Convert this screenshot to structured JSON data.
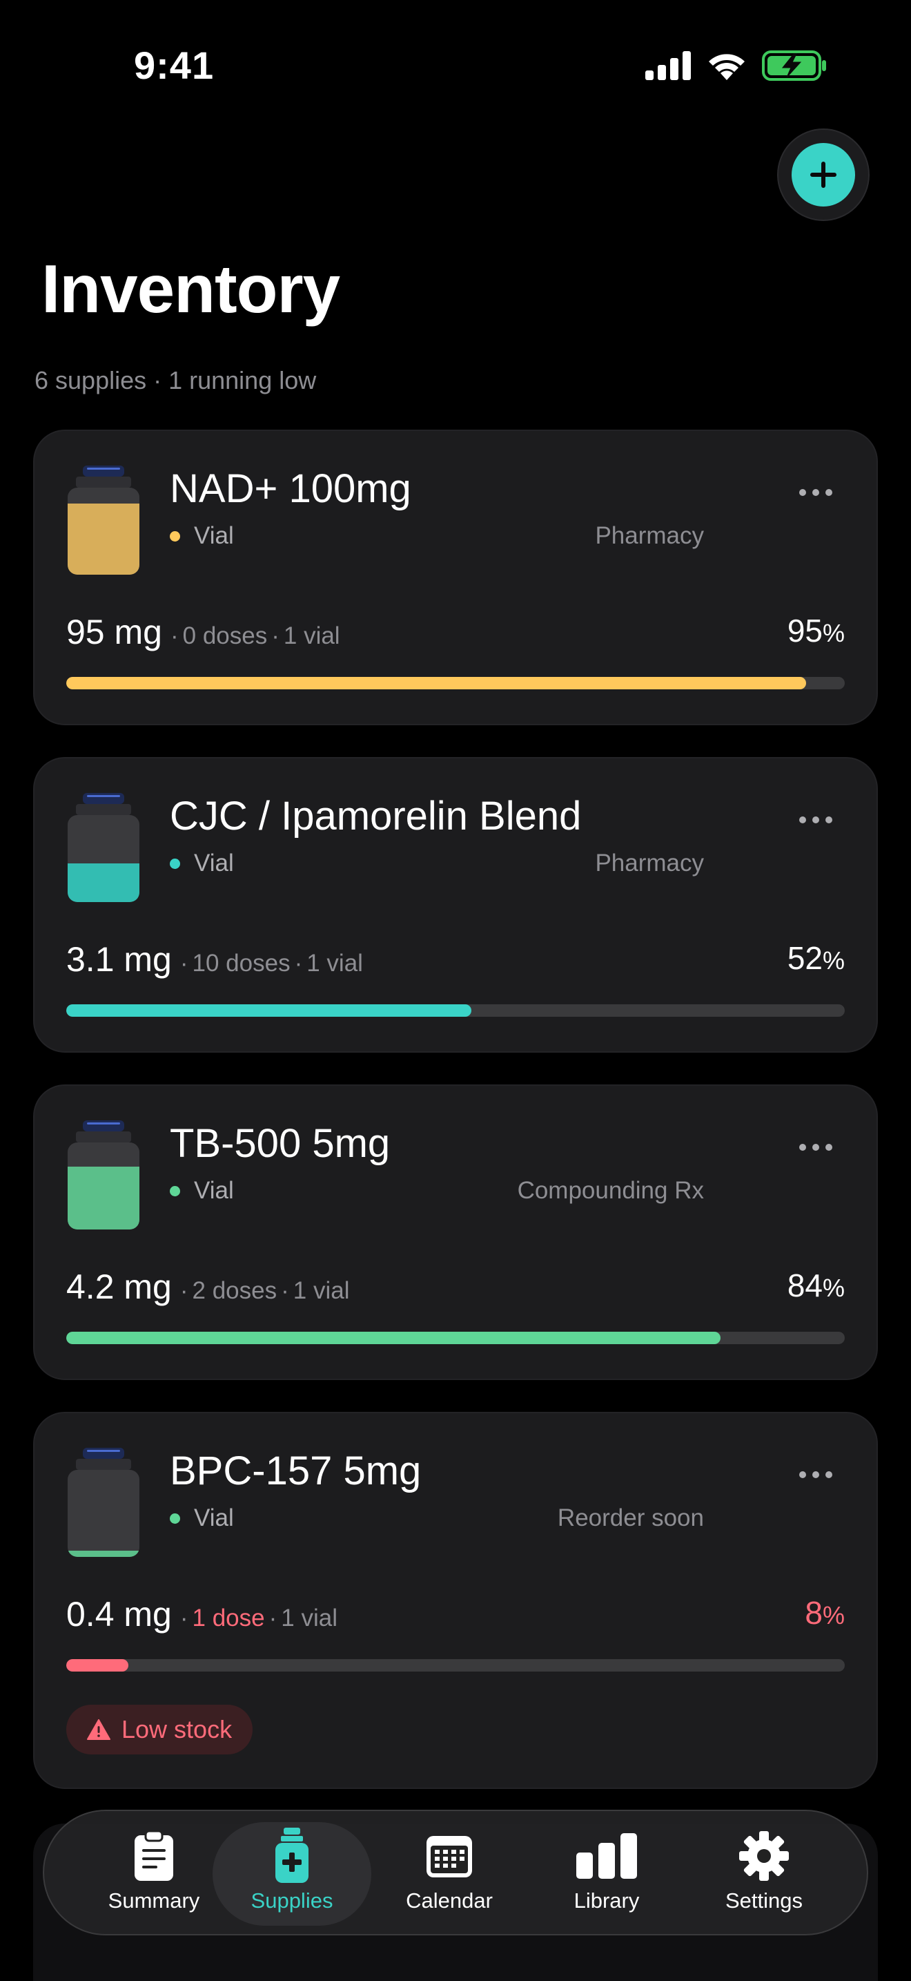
{
  "status": {
    "time": "9:41"
  },
  "header": {
    "title": "Inventory",
    "subtitle": "6 supplies · 1 running low"
  },
  "add_button": {
    "icon": "plus-icon"
  },
  "supplies": [
    {
      "name": "NAD+ 100mg",
      "type": "Vial",
      "source": "Pharmacy",
      "amount": "95 mg",
      "doses": "0 doses",
      "vials": "1 vial",
      "percent": "95",
      "percent_unit": "%",
      "fill": 0.95,
      "color": "#ffc95c",
      "liquid": "#d8ae5a"
    },
    {
      "name": "CJC / Ipamorelin Blend",
      "type": "Vial",
      "source": "Pharmacy",
      "amount": "3.1 mg",
      "doses": "10 doses",
      "vials": "1 vial",
      "percent": "52",
      "percent_unit": "%",
      "fill": 0.52,
      "color": "#3ad3c7",
      "liquid": "#33bdb2"
    },
    {
      "name": "TB-500 5mg",
      "type": "Vial",
      "source": "Compounding Rx",
      "amount": "4.2 mg",
      "doses": "2 doses",
      "vials": "1 vial",
      "percent": "84",
      "percent_unit": "%",
      "fill": 0.84,
      "color": "#5fd697",
      "liquid": "#5bbf8a"
    },
    {
      "name": "BPC-157 5mg",
      "type": "Vial",
      "source": "Reorder soon",
      "amount": "0.4 mg",
      "doses": "1 dose",
      "vials": "1 vial",
      "percent": "8",
      "percent_unit": "%",
      "fill": 0.08,
      "color": "#ff6b7a",
      "liquid": "#5bbf8a",
      "badge": "Low stock"
    }
  ],
  "tabs": [
    {
      "label": "Summary",
      "icon": "clipboard-icon"
    },
    {
      "label": "Supplies",
      "icon": "vial-icon",
      "active": true
    },
    {
      "label": "Calendar",
      "icon": "calendar-icon"
    },
    {
      "label": "Library",
      "icon": "bar-chart-icon"
    },
    {
      "label": "Settings",
      "icon": "gear-icon"
    }
  ],
  "colors": {
    "accent": "#3ad3c7",
    "background": "#000000",
    "card": "#1c1c1e",
    "danger": "#ff6b7a"
  }
}
